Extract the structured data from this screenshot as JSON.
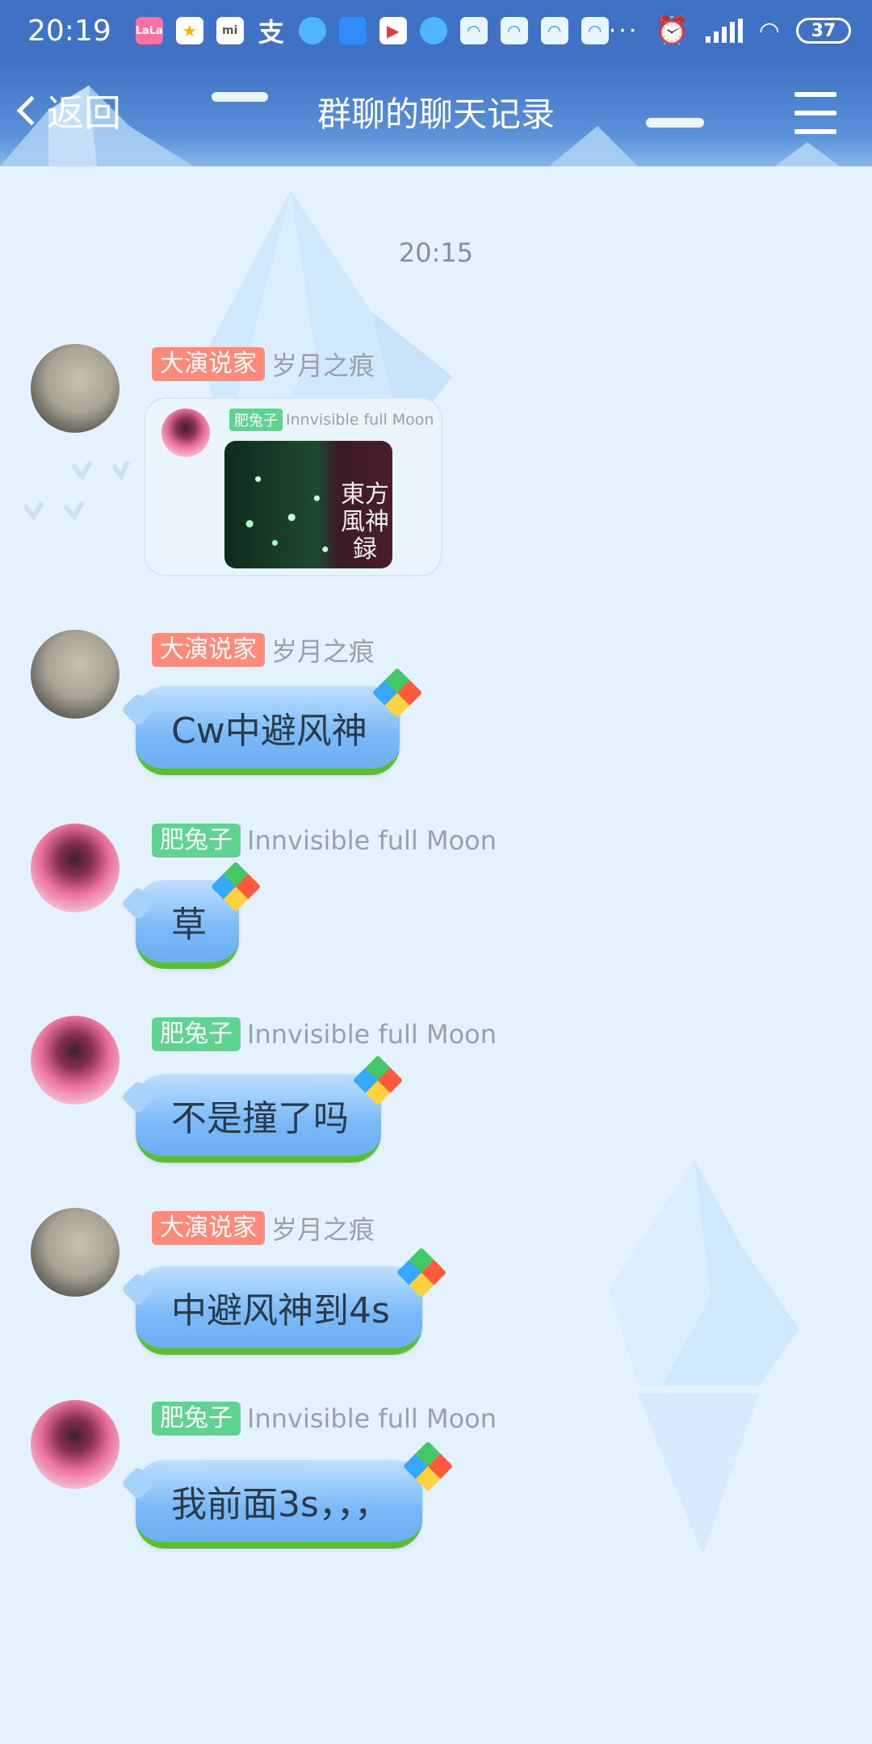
{
  "status_bar": {
    "time": "20:19",
    "notif_icons": [
      "lala-app-icon",
      "star-app-icon",
      "mi-app-icon",
      "alipay-icon",
      "browser-icon",
      "doc-icon",
      "play-icon",
      "browser-icon",
      "qq-icon",
      "qq-icon",
      "qq-icon",
      "qq-icon"
    ],
    "more": "···",
    "battery": "37"
  },
  "header": {
    "back_label": "返回",
    "title": "群聊的聊天记录"
  },
  "chat": {
    "timestamp": "20:15",
    "messages": [
      {
        "title": "大演说家",
        "title_color": "#ff8a7a",
        "nickname": "岁月之痕",
        "type": "forward",
        "forward": {
          "title": "肥兔子",
          "nickname": "Innvisible full Moon",
          "image_text": "東方風神録"
        }
      },
      {
        "title": "大演说家",
        "title_color": "#ff8a7a",
        "nickname": "岁月之痕",
        "text": "Cw中避风神"
      },
      {
        "title": "肥兔子",
        "title_color": "#5fd48e",
        "nickname": "Innvisible full Moon",
        "text": "草"
      },
      {
        "title": "肥兔子",
        "title_color": "#5fd48e",
        "nickname": "Innvisible full Moon",
        "text": "不是撞了吗"
      },
      {
        "title": "大演说家",
        "title_color": "#ff8a7a",
        "nickname": "岁月之痕",
        "text": "中避风神到4s"
      },
      {
        "title": "肥兔子",
        "title_color": "#5fd48e",
        "nickname": "Innvisible full Moon",
        "text": "我前面3s，，，"
      }
    ]
  }
}
